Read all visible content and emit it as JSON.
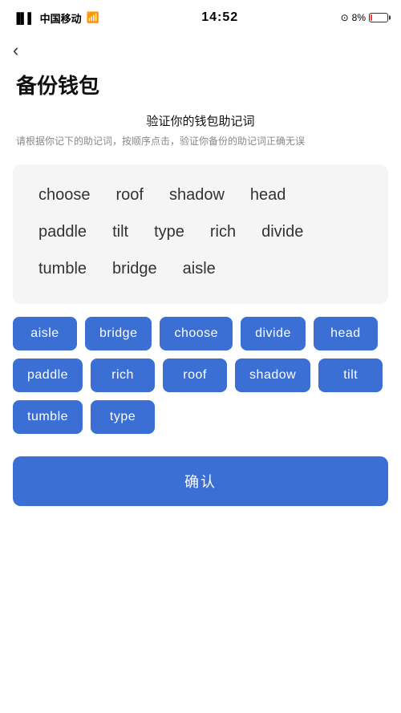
{
  "statusBar": {
    "carrier": "中国移动",
    "time": "14:52",
    "battery": "8%"
  },
  "nav": {
    "backArrow": "‹"
  },
  "page": {
    "title": "备份钱包",
    "instructionTitle": "验证你的钱包助记词",
    "instructionDesc": "请根据你记下的助记词，按顺序点击，验证你备份的助记词正确无误"
  },
  "displayWords": [
    [
      "choose",
      "roof",
      "shadow",
      "head"
    ],
    [
      "paddle",
      "tilt",
      "type",
      "rich",
      "divide"
    ],
    [
      "tumble",
      "bridge",
      "aisle"
    ]
  ],
  "wordButtons": [
    "aisle",
    "bridge",
    "choose",
    "divide",
    "head",
    "paddle",
    "rich",
    "roof",
    "shadow",
    "tilt",
    "tumble",
    "type"
  ],
  "confirmLabel": "确认",
  "colors": {
    "accent": "#3b6fd4",
    "background": "#f5f5f5"
  }
}
